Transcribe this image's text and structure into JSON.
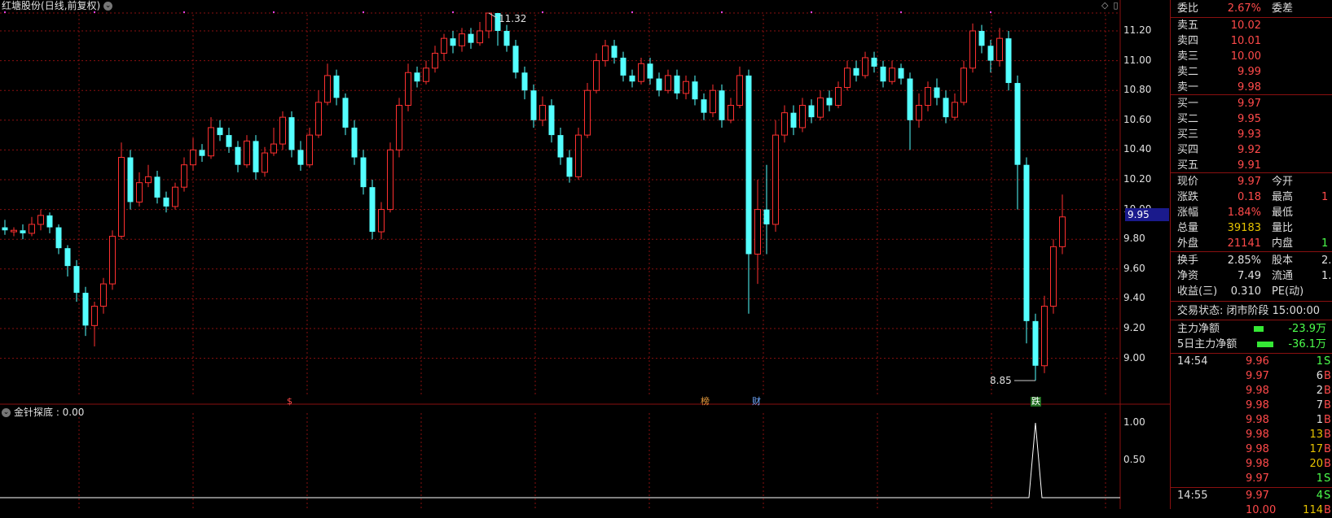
{
  "title": {
    "stock": "红塘股份",
    "mode": "(日线,前复权)"
  },
  "top_icons": [
    "diamond-icon",
    "window-icon"
  ],
  "price_axis": [
    "11.20",
    "11.00",
    "10.80",
    "10.60",
    "10.40",
    "10.20",
    "10.00",
    "9.80",
    "9.60",
    "9.40",
    "9.20",
    "9.00"
  ],
  "current_price_tag": "9.95",
  "annotations": {
    "high": "11.32",
    "low": "8.85"
  },
  "event_markers": [
    {
      "label": "$",
      "color": "#ff4a4a"
    },
    {
      "label": "榜",
      "color": "#e69a3c"
    },
    {
      "label": "财",
      "color": "#6fa8ff"
    },
    {
      "label": "跌",
      "color": "#4cff4c"
    }
  ],
  "indicator": {
    "title": "金针探底 : 0.00",
    "axis": [
      "1.00",
      "0.50"
    ],
    "line_color": "#ffffff"
  },
  "colors": {
    "up": "#ff3030",
    "down": "#54ffff",
    "grid": "#8a1010",
    "axis_text": "#e0e0e0"
  },
  "chart_data": {
    "type": "candlestick",
    "title": "",
    "ylim": [
      8.85,
      11.32
    ],
    "candles": [
      [
        9.88,
        9.86,
        9.93,
        9.83
      ],
      [
        9.85,
        9.86,
        9.88,
        9.82
      ],
      [
        9.86,
        9.84,
        9.9,
        9.8
      ],
      [
        9.84,
        9.9,
        9.95,
        9.82
      ],
      [
        9.9,
        9.96,
        10.0,
        9.86
      ],
      [
        9.96,
        9.88,
        9.98,
        9.84
      ],
      [
        9.88,
        9.74,
        9.9,
        9.7
      ],
      [
        9.74,
        9.62,
        9.76,
        9.55
      ],
      [
        9.62,
        9.44,
        9.66,
        9.38
      ],
      [
        9.44,
        9.22,
        9.48,
        9.15
      ],
      [
        9.22,
        9.35,
        9.38,
        9.08
      ],
      [
        9.35,
        9.5,
        9.54,
        9.3
      ],
      [
        9.5,
        9.82,
        9.86,
        9.46
      ],
      [
        9.82,
        10.35,
        10.45,
        9.8
      ],
      [
        10.35,
        10.05,
        10.4,
        10.0
      ],
      [
        10.05,
        10.18,
        10.25,
        10.02
      ],
      [
        10.18,
        10.22,
        10.3,
        10.15
      ],
      [
        10.22,
        10.08,
        10.26,
        10.04
      ],
      [
        10.08,
        10.02,
        10.12,
        9.98
      ],
      [
        10.02,
        10.15,
        10.18,
        10.0
      ],
      [
        10.15,
        10.3,
        10.35,
        10.12
      ],
      [
        10.3,
        10.4,
        10.48,
        10.26
      ],
      [
        10.4,
        10.36,
        10.44,
        10.32
      ],
      [
        10.36,
        10.55,
        10.62,
        10.34
      ],
      [
        10.55,
        10.5,
        10.6,
        10.46
      ],
      [
        10.5,
        10.42,
        10.55,
        10.38
      ],
      [
        10.42,
        10.3,
        10.46,
        10.25
      ],
      [
        10.3,
        10.46,
        10.5,
        10.28
      ],
      [
        10.46,
        10.25,
        10.5,
        10.2
      ],
      [
        10.25,
        10.38,
        10.42,
        10.22
      ],
      [
        10.38,
        10.44,
        10.55,
        10.36
      ],
      [
        10.44,
        10.62,
        10.66,
        10.4
      ],
      [
        10.62,
        10.4,
        10.66,
        10.35
      ],
      [
        10.4,
        10.3,
        10.46,
        10.26
      ],
      [
        10.3,
        10.5,
        10.55,
        10.28
      ],
      [
        10.5,
        10.72,
        10.8,
        10.48
      ],
      [
        10.72,
        10.9,
        10.98,
        10.7
      ],
      [
        10.9,
        10.75,
        10.94,
        10.7
      ],
      [
        10.75,
        10.55,
        10.78,
        10.5
      ],
      [
        10.55,
        10.35,
        10.6,
        10.3
      ],
      [
        10.35,
        10.15,
        10.4,
        10.1
      ],
      [
        10.15,
        9.85,
        10.2,
        9.8
      ],
      [
        9.85,
        10.0,
        10.05,
        9.8
      ],
      [
        10.0,
        10.4,
        10.45,
        9.98
      ],
      [
        10.4,
        10.7,
        10.75,
        10.35
      ],
      [
        10.7,
        10.92,
        10.98,
        10.66
      ],
      [
        10.92,
        10.86,
        10.96,
        10.82
      ],
      [
        10.86,
        10.95,
        11.0,
        10.84
      ],
      [
        10.95,
        11.05,
        11.1,
        10.92
      ],
      [
        11.05,
        11.15,
        11.18,
        11.0
      ],
      [
        11.15,
        11.1,
        11.2,
        11.05
      ],
      [
        11.1,
        11.18,
        11.22,
        11.06
      ],
      [
        11.18,
        11.12,
        11.22,
        11.08
      ],
      [
        11.12,
        11.2,
        11.26,
        11.1
      ],
      [
        11.2,
        11.32,
        11.32,
        11.15
      ],
      [
        11.32,
        11.2,
        11.32,
        11.1
      ],
      [
        11.2,
        11.1,
        11.24,
        11.06
      ],
      [
        11.1,
        10.92,
        11.14,
        10.88
      ],
      [
        10.92,
        10.8,
        10.96,
        10.74
      ],
      [
        10.8,
        10.6,
        10.84,
        10.55
      ],
      [
        10.6,
        10.7,
        10.76,
        10.56
      ],
      [
        10.7,
        10.5,
        10.74,
        10.45
      ],
      [
        10.5,
        10.35,
        10.55,
        10.3
      ],
      [
        10.35,
        10.22,
        10.4,
        10.18
      ],
      [
        10.22,
        10.5,
        10.55,
        10.2
      ],
      [
        10.5,
        10.8,
        10.85,
        10.48
      ],
      [
        10.8,
        11.0,
        11.05,
        10.78
      ],
      [
        11.0,
        11.1,
        11.14,
        10.96
      ],
      [
        11.1,
        11.02,
        11.14,
        10.98
      ],
      [
        11.02,
        10.9,
        11.06,
        10.86
      ],
      [
        10.9,
        10.86,
        10.94,
        10.82
      ],
      [
        10.86,
        10.98,
        11.02,
        10.84
      ],
      [
        10.98,
        10.88,
        11.02,
        10.84
      ],
      [
        10.88,
        10.8,
        10.92,
        10.76
      ],
      [
        10.8,
        10.9,
        10.94,
        10.78
      ],
      [
        10.9,
        10.78,
        10.94,
        10.74
      ],
      [
        10.78,
        10.86,
        10.9,
        10.74
      ],
      [
        10.86,
        10.74,
        10.9,
        10.7
      ],
      [
        10.74,
        10.65,
        10.78,
        10.6
      ],
      [
        10.65,
        10.8,
        10.84,
        10.62
      ],
      [
        10.8,
        10.6,
        10.84,
        10.55
      ],
      [
        10.6,
        10.7,
        10.75,
        10.58
      ],
      [
        10.7,
        10.9,
        10.96,
        10.68
      ],
      [
        10.9,
        9.7,
        10.94,
        9.3
      ],
      [
        9.7,
        10.0,
        10.2,
        9.5
      ],
      [
        10.0,
        9.9,
        10.3,
        9.7
      ],
      [
        9.9,
        10.5,
        10.6,
        9.85
      ],
      [
        10.5,
        10.65,
        10.7,
        10.45
      ],
      [
        10.65,
        10.55,
        10.7,
        10.5
      ],
      [
        10.55,
        10.7,
        10.75,
        10.52
      ],
      [
        10.7,
        10.62,
        10.74,
        10.58
      ],
      [
        10.62,
        10.75,
        10.8,
        10.6
      ],
      [
        10.75,
        10.7,
        10.8,
        10.66
      ],
      [
        10.7,
        10.82,
        10.86,
        10.68
      ],
      [
        10.82,
        10.95,
        11.0,
        10.8
      ],
      [
        10.95,
        10.9,
        11.0,
        10.86
      ],
      [
        10.9,
        11.02,
        11.06,
        10.88
      ],
      [
        11.02,
        10.96,
        11.06,
        10.92
      ],
      [
        10.96,
        10.86,
        11.0,
        10.82
      ],
      [
        10.86,
        10.95,
        11.0,
        10.84
      ],
      [
        10.95,
        10.88,
        10.98,
        10.84
      ],
      [
        10.88,
        10.6,
        10.92,
        10.4
      ],
      [
        10.6,
        10.7,
        10.78,
        10.55
      ],
      [
        10.7,
        10.82,
        10.86,
        10.66
      ],
      [
        10.82,
        10.75,
        10.88,
        10.7
      ],
      [
        10.75,
        10.62,
        10.8,
        10.58
      ],
      [
        10.62,
        10.72,
        10.78,
        10.6
      ],
      [
        10.72,
        10.95,
        11.0,
        10.7
      ],
      [
        10.95,
        11.2,
        11.25,
        10.92
      ],
      [
        11.2,
        11.1,
        11.24,
        11.05
      ],
      [
        11.1,
        11.0,
        11.14,
        10.92
      ],
      [
        11.0,
        11.15,
        11.22,
        10.96
      ],
      [
        11.15,
        10.85,
        11.2,
        10.8
      ],
      [
        10.85,
        10.3,
        10.9,
        10.0
      ],
      [
        10.3,
        9.25,
        10.35,
        9.1
      ],
      [
        9.25,
        8.95,
        9.3,
        8.85
      ],
      [
        8.95,
        9.35,
        9.42,
        8.9
      ],
      [
        9.35,
        9.75,
        9.8,
        9.3
      ],
      [
        9.75,
        9.95,
        10.1,
        9.7
      ]
    ]
  },
  "panel": {
    "weibi": {
      "label": "委比",
      "value": "2.67%",
      "label2": "委差"
    },
    "sells": [
      {
        "label": "卖五",
        "price": "10.02"
      },
      {
        "label": "卖四",
        "price": "10.01"
      },
      {
        "label": "卖三",
        "price": "10.00"
      },
      {
        "label": "卖二",
        "price": "9.99"
      },
      {
        "label": "卖一",
        "price": "9.98"
      }
    ],
    "buys": [
      {
        "label": "买一",
        "price": "9.97"
      },
      {
        "label": "买二",
        "price": "9.95"
      },
      {
        "label": "买三",
        "price": "9.93"
      },
      {
        "label": "买四",
        "price": "9.92"
      },
      {
        "label": "买五",
        "price": "9.91"
      }
    ],
    "quote": [
      {
        "l": "现价",
        "v": "9.97",
        "vc": "red",
        "l2": "今开",
        "v2": ""
      },
      {
        "l": "涨跌",
        "v": "0.18",
        "vc": "red",
        "l2": "最高",
        "v2": "1"
      },
      {
        "l": "涨幅",
        "v": "1.84%",
        "vc": "red",
        "l2": "最低",
        "v2": ""
      },
      {
        "l": "总量",
        "v": "39183",
        "vc": "yellow",
        "l2": "量比",
        "v2": ""
      },
      {
        "l": "外盘",
        "v": "21141",
        "vc": "red",
        "l2": "内盘",
        "v2": "1"
      }
    ],
    "fund": [
      {
        "l": "换手",
        "v": "2.85%",
        "l2": "股本",
        "v2": "2."
      },
      {
        "l": "净资",
        "v": "7.49",
        "l2": "流通",
        "v2": "1."
      },
      {
        "l": "收益(三)",
        "v": "0.310",
        "l2": "PE(动)",
        "v2": ""
      }
    ],
    "status": "交易状态: 闭市阶段 15:00:00",
    "flows": [
      {
        "label": "主力净额",
        "value": "-23.9万"
      },
      {
        "label": "5日主力净额",
        "value": "-36.1万"
      }
    ],
    "ticks": [
      {
        "time": "14:54",
        "price": "9.96",
        "qty": "1",
        "side": "S"
      },
      {
        "time": "",
        "price": "9.97",
        "qty": "6",
        "side": "B"
      },
      {
        "time": "",
        "price": "9.98",
        "qty": "2",
        "side": "B"
      },
      {
        "time": "",
        "price": "9.98",
        "qty": "7",
        "side": "B"
      },
      {
        "time": "",
        "price": "9.98",
        "qty": "1",
        "side": "B"
      },
      {
        "time": "",
        "price": "9.98",
        "qty": "13",
        "side": "B"
      },
      {
        "time": "",
        "price": "9.98",
        "qty": "17",
        "side": "B"
      },
      {
        "time": "",
        "price": "9.98",
        "qty": "20",
        "side": "B"
      },
      {
        "time": "",
        "price": "9.97",
        "qty": "1",
        "side": "S"
      },
      {
        "time": "14:55",
        "price": "9.97",
        "qty": "4",
        "side": "S"
      },
      {
        "time": "",
        "price": "10.00",
        "qty": "114",
        "side": "B"
      }
    ]
  }
}
